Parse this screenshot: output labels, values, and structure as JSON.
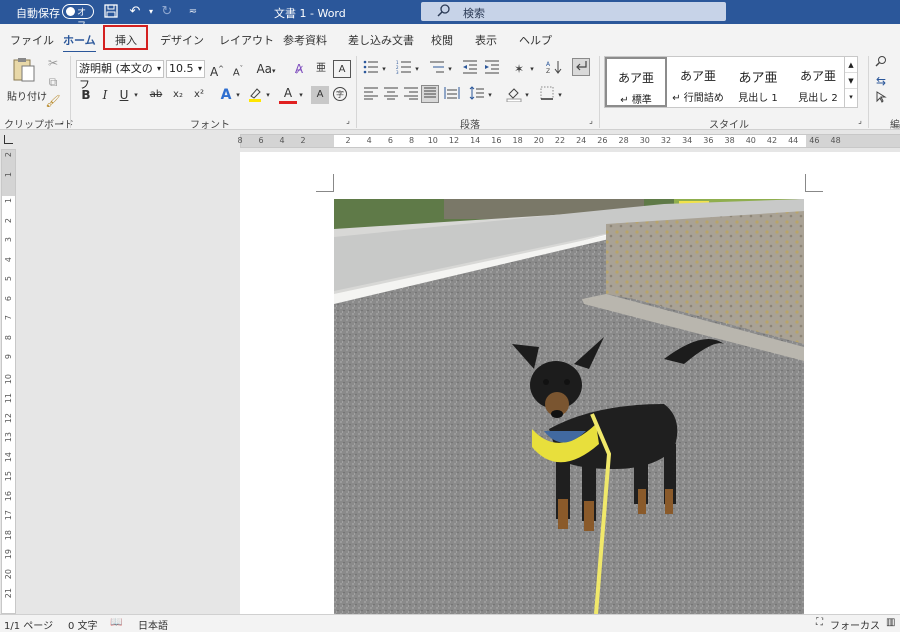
{
  "titlebar": {
    "autosave_label": "自動保存",
    "toggle_state": "オフ",
    "document_title": "文書 1  -  Word",
    "search_placeholder": "検索"
  },
  "tabs": [
    {
      "label": "ファイル"
    },
    {
      "label": "ホーム"
    },
    {
      "label": "挿入"
    },
    {
      "label": "デザイン"
    },
    {
      "label": "レイアウト"
    },
    {
      "label": "参考資料"
    },
    {
      "label": "差し込み文書"
    },
    {
      "label": "校閲"
    },
    {
      "label": "表示"
    },
    {
      "label": "ヘルプ"
    }
  ],
  "ribbon": {
    "clipboard": {
      "paste_label": "貼り付け",
      "group_label": "クリップボード"
    },
    "font": {
      "font_name": "游明朝 (本文のフ",
      "font_size": "10.5",
      "grow": "A",
      "shrink": "A",
      "case": "Aa",
      "bold": "B",
      "italic": "I",
      "underline": "U",
      "strike": "ab",
      "sub": "x₂",
      "sup": "x²",
      "text_effect": "A",
      "font_color": "A",
      "shade": "A",
      "group_label": "フォント"
    },
    "paragraph": {
      "group_label": "段落"
    },
    "styles": {
      "group_label": "スタイル",
      "items": [
        {
          "preview": "あア亜",
          "name": "↵ 標準"
        },
        {
          "preview": "あア亜",
          "name": "↵ 行間詰め"
        },
        {
          "preview": "あア亜",
          "name": "見出し 1"
        },
        {
          "preview": "あア亜",
          "name": "見出し 2"
        }
      ]
    },
    "editing": {
      "group_label": "編"
    }
  },
  "ruler": {
    "h_numbers": [
      "8",
      "6",
      "4",
      "2",
      "2",
      "4",
      "6",
      "8",
      "10",
      "12",
      "14",
      "16",
      "18",
      "20",
      "22",
      "24",
      "26",
      "28",
      "30",
      "32",
      "34",
      "36",
      "38",
      "40",
      "42",
      "44",
      "46",
      "48"
    ],
    "v_numbers": [
      "2",
      "1",
      "1",
      "2",
      "3",
      "4",
      "5",
      "6",
      "7",
      "8",
      "9",
      "10",
      "11",
      "12",
      "13",
      "14",
      "15",
      "16",
      "17",
      "18",
      "19",
      "20",
      "21"
    ]
  },
  "status": {
    "page": "1/1 ページ",
    "words": "0 文字",
    "language": "日本語",
    "focus": "フォーカス"
  },
  "colors": {
    "accent": "#2b579a",
    "highlight_box": "#d42020"
  }
}
